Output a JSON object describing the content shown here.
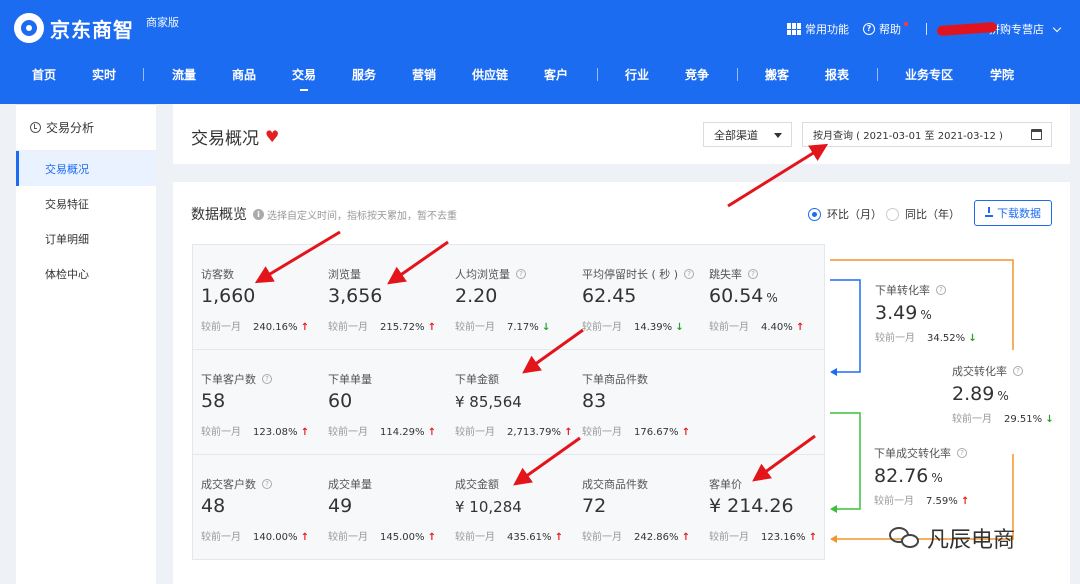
{
  "header": {
    "logo_text": "京东商智",
    "edition": "商家版",
    "common_functions": "常用功能",
    "help": "帮助",
    "store_name": "拼购专营店"
  },
  "nav": [
    {
      "label": "首页"
    },
    {
      "label": "实时"
    },
    {
      "label": "流量"
    },
    {
      "label": "商品"
    },
    {
      "label": "交易",
      "active": true
    },
    {
      "label": "服务"
    },
    {
      "label": "营销"
    },
    {
      "label": "供应链"
    },
    {
      "label": "客户"
    },
    {
      "label": "行业"
    },
    {
      "label": "竞争"
    },
    {
      "label": "搬客"
    },
    {
      "label": "报表"
    },
    {
      "label": "业务专区"
    },
    {
      "label": "学院"
    }
  ],
  "sidebar": {
    "section": "交易分析",
    "items": [
      {
        "label": "交易概况",
        "active": true
      },
      {
        "label": "交易特征"
      },
      {
        "label": "订单明细"
      },
      {
        "label": "体检中心"
      }
    ]
  },
  "title_card": {
    "title": "交易概况",
    "channel": "全部渠道",
    "date_range": "按月查询 ( 2021-03-01 至 2021-03-12 )"
  },
  "data_card": {
    "title": "数据概览",
    "hint": "选择自定义时间，指标按天累加，暂不去重",
    "radio_mom": "环比（月）",
    "radio_yoy": "同比（年）",
    "download": "下载数据"
  },
  "compare_label": "较前一月",
  "metrics": {
    "row1": [
      {
        "label": "访客数",
        "value": "1,660",
        "pct": "240.16%",
        "dir": "↑"
      },
      {
        "label": "浏览量",
        "value": "3,656",
        "pct": "215.72%",
        "dir": "↑"
      },
      {
        "label": "人均浏览量",
        "value": "2.20",
        "pct": "7.17%",
        "dir": "↓"
      },
      {
        "label": "平均停留时长 ( 秒 )",
        "value": "62.45",
        "pct": "14.39%",
        "dir": "↓"
      },
      {
        "label": "跳失率",
        "value": "60.54",
        "unit": "%",
        "pct": "4.40%",
        "dir": "↑"
      }
    ],
    "row2": [
      {
        "label": "下单客户数",
        "value": "58",
        "pct": "123.08%",
        "dir": "↑"
      },
      {
        "label": "下单单量",
        "value": "60",
        "pct": "114.29%",
        "dir": "↑"
      },
      {
        "label": "下单金额",
        "value": "¥ 85,564",
        "pct": "2,713.79%",
        "dir": "↑"
      },
      {
        "label": "下单商品件数",
        "value": "83",
        "pct": "176.67%",
        "dir": "↑"
      }
    ],
    "row3": [
      {
        "label": "成交客户数",
        "value": "48",
        "pct": "140.00%",
        "dir": "↑"
      },
      {
        "label": "成交单量",
        "value": "49",
        "pct": "145.00%",
        "dir": "↑"
      },
      {
        "label": "成交金额",
        "value": "¥ 10,284",
        "pct": "435.61%",
        "dir": "↑"
      },
      {
        "label": "成交商品件数",
        "value": "72",
        "pct": "242.86%",
        "dir": "↑"
      },
      {
        "label": "客单价",
        "value": "¥ 214.26",
        "pct": "123.16%",
        "dir": "↑"
      }
    ]
  },
  "conversions": [
    {
      "label": "下单转化率",
      "value": "3.49",
      "unit": "%",
      "pct": "34.52%",
      "dir": "↓"
    },
    {
      "label": "成交转化率",
      "value": "2.89",
      "unit": "%",
      "pct": "29.51%",
      "dir": "↓"
    },
    {
      "label": "下单成交转化率",
      "value": "82.76",
      "unit": "%",
      "pct": "7.59%",
      "dir": "↑"
    }
  ],
  "watermark": "凡辰电商",
  "colors": {
    "brand_blue": "#1c6cf2",
    "up_red": "#e32020",
    "down_green": "#2ca02c",
    "flow_orange": "#f0962a",
    "flow_green": "#3bbf3b",
    "annotation_red": "#e3151b"
  }
}
